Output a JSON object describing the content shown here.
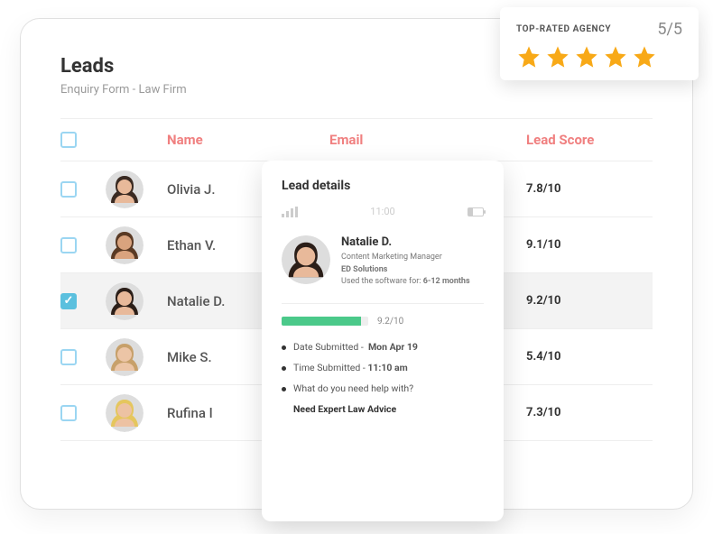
{
  "page": {
    "title": "Leads",
    "subtitle": "Enquiry Form - Law Firm"
  },
  "rating": {
    "label": "TOP-RATED AGENCY",
    "score": "5/5",
    "stars": 5
  },
  "columns": {
    "name": "Name",
    "email": "Email",
    "score": "Lead Score"
  },
  "rows": [
    {
      "name": "Olivia J.",
      "score": "7.8/10",
      "checked": false,
      "avatar": {
        "skin": "#e8b99a",
        "hair": "#3a2a22"
      }
    },
    {
      "name": "Ethan V.",
      "score": "9.1/10",
      "checked": false,
      "avatar": {
        "skin": "#d9a37e",
        "hair": "#5a3a24"
      }
    },
    {
      "name": "Natalie D.",
      "score": "9.2/10",
      "checked": true,
      "avatar": {
        "skin": "#e8b99a",
        "hair": "#2b1e18"
      }
    },
    {
      "name": "Mike S.",
      "score": "5.4/10",
      "checked": false,
      "avatar": {
        "skin": "#ecc5a6",
        "hair": "#c7a06a"
      }
    },
    {
      "name": "Rufina l",
      "score": "7.3/10",
      "checked": false,
      "avatar": {
        "skin": "#edc2a3",
        "hair": "#e5c65e"
      }
    }
  ],
  "detail": {
    "heading": "Lead details",
    "clock": "11:00",
    "name": "Natalie D.",
    "role": "Content Marketing Manager",
    "company": "ED Solutions",
    "used_label": "Used the software for:",
    "used_value": "6-12 months",
    "score": "9.2/10",
    "score_pct": 92,
    "date_label": "Date Submitted -",
    "date_value": "Mon Apr 19",
    "time_label": "Time Submitted -",
    "time_value": "11:10 am",
    "help_q": "What do you need help with?",
    "help_a": "Need Expert Law Advice",
    "avatar": {
      "skin": "#e8b99a",
      "hair": "#2b1e18"
    }
  }
}
